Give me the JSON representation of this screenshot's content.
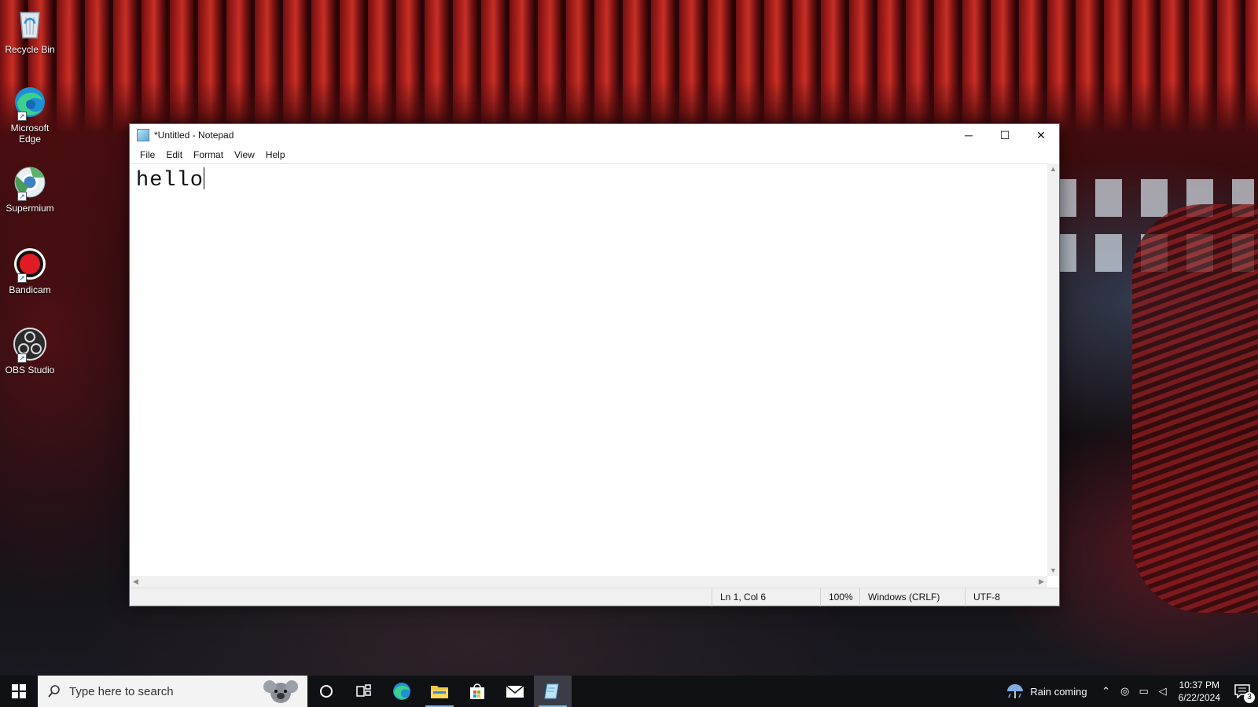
{
  "desktop": {
    "icons": [
      {
        "label": "Recycle Bin",
        "icon": "recycle-bin-icon"
      },
      {
        "label": "Microsoft Edge",
        "icon": "edge-icon"
      },
      {
        "label": "Supermium",
        "icon": "supermium-icon"
      },
      {
        "label": "Bandicam",
        "icon": "bandicam-icon"
      },
      {
        "label": "OBS Studio",
        "icon": "obs-icon"
      }
    ]
  },
  "notepad": {
    "title": "*Untitled - Notepad",
    "menu": [
      "File",
      "Edit",
      "Format",
      "View",
      "Help"
    ],
    "content": "hello",
    "status": {
      "position": "Ln 1, Col 6",
      "zoom": "100%",
      "line_ending": "Windows (CRLF)",
      "encoding": "UTF-8"
    },
    "controls": {
      "minimize": "─",
      "maximize": "☐",
      "close": "✕"
    }
  },
  "taskbar": {
    "search_placeholder": "Type here to search",
    "weather": "Rain coming",
    "time": "10:37 PM",
    "date": "6/22/2024",
    "notification_count": "3",
    "accent": "#76b9ed"
  }
}
